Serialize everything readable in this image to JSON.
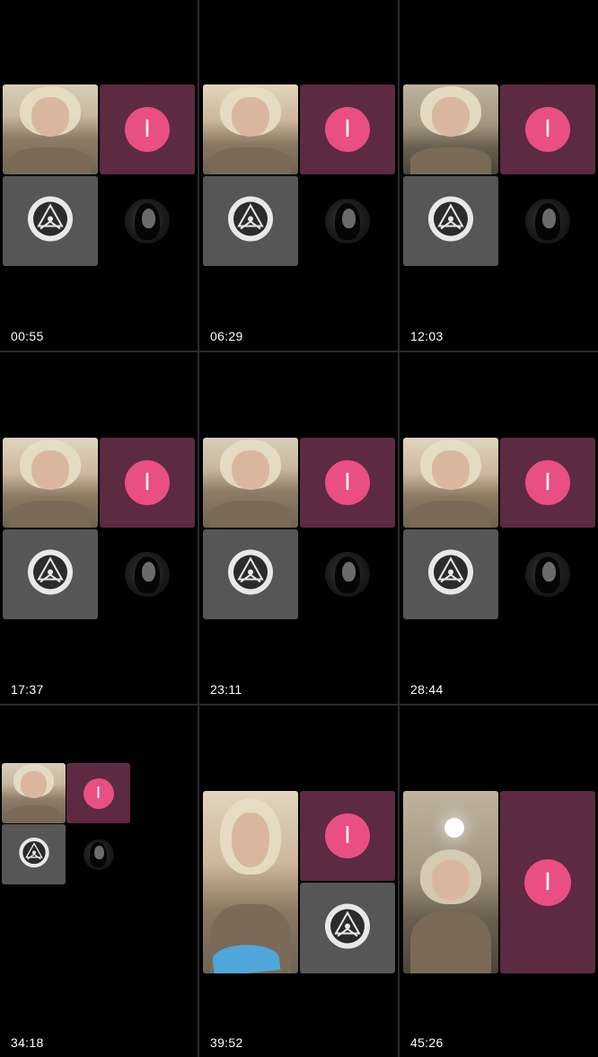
{
  "screen": {
    "title": "",
    "colors": {
      "background": "#000000",
      "divider": "#2a2a2a",
      "pink_tile": "#5c2a41",
      "avatar_circle": "#e94f82",
      "emblem_tile": "#565656"
    }
  },
  "thumbnails": [
    {
      "timestamp": "00:55",
      "avatar_letter": "I",
      "emblem_icon": "masonic-emblem-icon",
      "portrait_icon": "portrait-avatar-icon"
    },
    {
      "timestamp": "06:29",
      "avatar_letter": "I",
      "emblem_icon": "masonic-emblem-icon",
      "portrait_icon": "portrait-avatar-icon"
    },
    {
      "timestamp": "12:03",
      "avatar_letter": "I",
      "emblem_icon": "masonic-emblem-icon",
      "portrait_icon": "portrait-avatar-icon"
    },
    {
      "timestamp": "17:37",
      "avatar_letter": "I",
      "emblem_icon": "masonic-emblem-icon",
      "portrait_icon": "portrait-avatar-icon"
    },
    {
      "timestamp": "23:11",
      "avatar_letter": "I",
      "emblem_icon": "masonic-emblem-icon",
      "portrait_icon": "portrait-avatar-icon"
    },
    {
      "timestamp": "28:44",
      "avatar_letter": "I",
      "emblem_icon": "masonic-emblem-icon",
      "portrait_icon": "portrait-avatar-icon"
    },
    {
      "timestamp": "34:18",
      "avatar_letter": "I",
      "emblem_icon": "masonic-emblem-icon",
      "portrait_icon": "portrait-avatar-icon"
    },
    {
      "timestamp": "39:52",
      "avatar_letter": "I",
      "emblem_icon": "masonic-emblem-icon"
    },
    {
      "timestamp": "45:26",
      "avatar_letter": "I"
    }
  ]
}
